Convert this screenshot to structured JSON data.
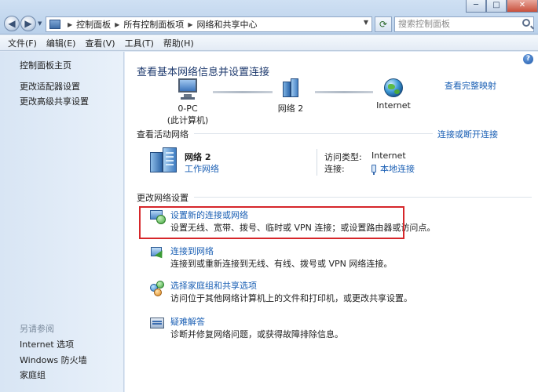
{
  "address": {
    "crumbs": [
      "控制面板",
      "所有控制面板项",
      "网络和共享中心"
    ],
    "search_placeholder": "搜索控制面板"
  },
  "menu": [
    "文件(F)",
    "编辑(E)",
    "查看(V)",
    "工具(T)",
    "帮助(H)"
  ],
  "sidebar": {
    "home": "控制面板主页",
    "links": [
      "更改适配器设置",
      "更改高级共享设置"
    ],
    "see_also_title": "另请参阅",
    "see_also": [
      "Internet 选项",
      "Windows 防火墙",
      "家庭组"
    ]
  },
  "main": {
    "title": "查看基本网络信息并设置连接",
    "view_full_map": "查看完整映射",
    "map": {
      "computer_line1": "0-PC",
      "computer_line2": "(此计算机)",
      "network": "网络  2",
      "internet": "Internet"
    },
    "active_section": "查看活动网络",
    "connect_toggle": "连接或断开连接",
    "active_network": {
      "name": "网络  2",
      "type": "工作网络",
      "access_type_label": "访问类型:",
      "access_type_value": "Internet",
      "connections_label": "连接:",
      "connections_value": "本地连接"
    },
    "change_section": "更改网络设置",
    "tasks": [
      {
        "title": "设置新的连接或网络",
        "desc": "设置无线、宽带、拨号、临时或 VPN 连接；或设置路由器或访问点。"
      },
      {
        "title": "连接到网络",
        "desc": "连接到或重新连接到无线、有线、拨号或 VPN 网络连接。"
      },
      {
        "title": "选择家庭组和共享选项",
        "desc": "访问位于其他网络计算机上的文件和打印机，或更改共享设置。"
      },
      {
        "title": "疑难解答",
        "desc": "诊断并修复网络问题，或获得故障排除信息。"
      }
    ]
  },
  "colors": {
    "link": "#1a5fb4",
    "highlight_border": "#d6262a",
    "title": "#1e3a6e"
  }
}
